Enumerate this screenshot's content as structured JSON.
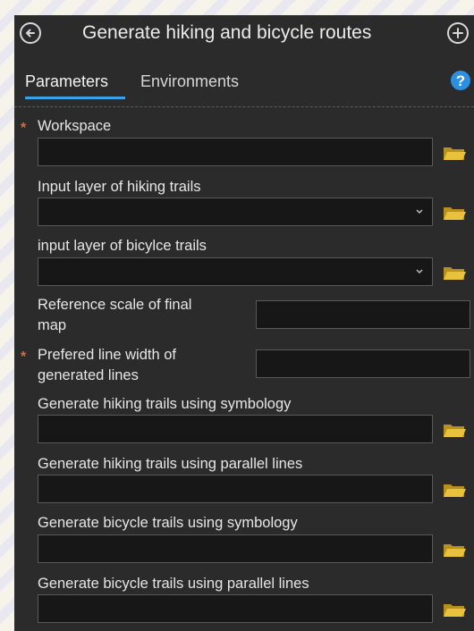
{
  "header": {
    "title": "Generate hiking and bicycle routes",
    "back_icon": "back-arrow-circle-icon",
    "add_icon": "add-circle-icon"
  },
  "tabs": [
    {
      "label": "Parameters",
      "active": true
    },
    {
      "label": "Environments",
      "active": false
    }
  ],
  "help": {
    "icon": "help-icon",
    "glyph": "?"
  },
  "colors": {
    "panel": "#2b2b2b",
    "input": "#171717",
    "accent": "#3aa0e6",
    "required": "#e36b2b",
    "folder": "#e8c23c"
  },
  "required_marker": "*",
  "params": [
    {
      "label": "Workspace",
      "value": "",
      "required": true,
      "dropdown": false,
      "browse": true
    },
    {
      "label": "Input layer of hiking trails",
      "value": "",
      "required": false,
      "dropdown": true,
      "browse": true
    },
    {
      "label": "input layer of bicylce trails",
      "value": "",
      "required": false,
      "dropdown": true,
      "browse": true
    },
    {
      "label_line1": "Reference scale of final",
      "label_line2": "map",
      "value": "",
      "required": false
    },
    {
      "label_line1": "Prefered line width of",
      "label_line2": "generated lines",
      "value": "",
      "required": true
    },
    {
      "label": "Generate hiking trails using symbology",
      "value": "",
      "required": false,
      "dropdown": false,
      "browse": true
    },
    {
      "label": "Generate hiking trails using parallel lines",
      "value": "",
      "required": false,
      "dropdown": false,
      "browse": true
    },
    {
      "label": "Generate bicycle trails using symbology",
      "value": "",
      "required": false,
      "dropdown": false,
      "browse": true
    },
    {
      "label": "Generate bicycle trails using parallel lines",
      "value": "",
      "required": false,
      "dropdown": false,
      "browse": true
    }
  ]
}
